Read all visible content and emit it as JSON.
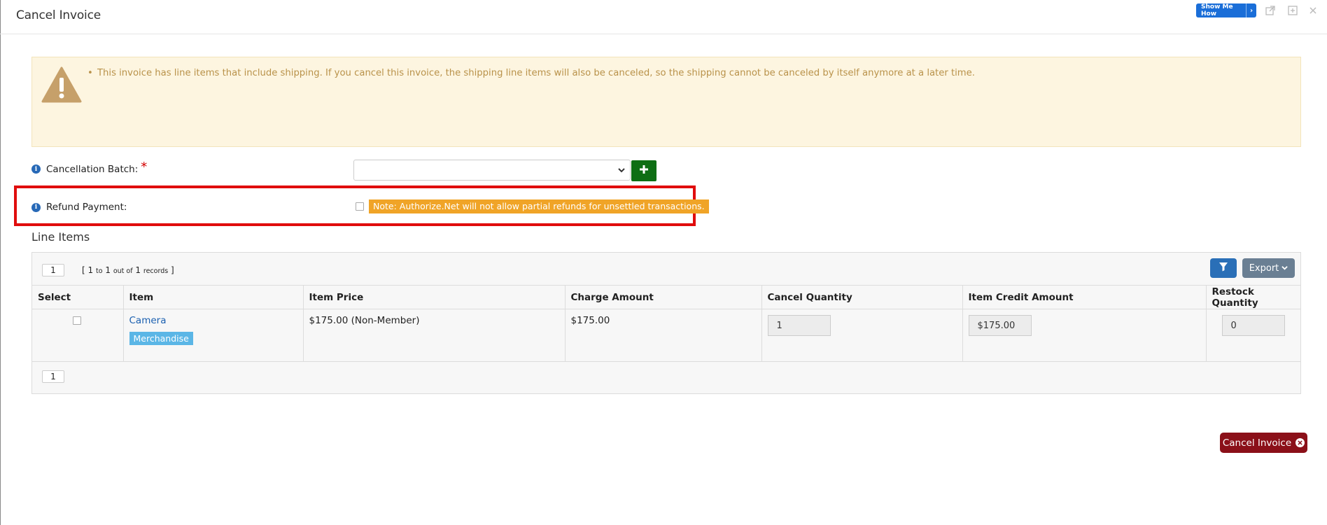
{
  "window": {
    "title": "Cancel Invoice",
    "show_me_how_label": "Show Me How"
  },
  "alert": {
    "message": "This invoice has line items that include shipping. If you cancel this invoice, the shipping line items will also be canceled, so the shipping cannot be canceled by itself anymore at a later time."
  },
  "form": {
    "cancellation_batch_label": "Cancellation Batch:",
    "required_marker": "*",
    "cancellation_batch_value": "",
    "refund_payment_label": "Refund Payment:",
    "refund_payment_checked": false,
    "refund_note": "Note: Authorize.Net will not allow partial refunds for unsettled transactions."
  },
  "line_items": {
    "section_title": "Line Items",
    "page_size": "1",
    "records_open": "[",
    "records_from": "1",
    "records_to_word": "to",
    "records_to": "1",
    "records_out_of_word": "out of",
    "records_total": "1",
    "records_word": "records",
    "records_close": "]",
    "export_label": "Export",
    "columns": [
      "Select",
      "Item",
      "Item Price",
      "Charge Amount",
      "Cancel Quantity",
      "Item Credit Amount",
      "Restock Quantity"
    ],
    "rows": [
      {
        "selected": false,
        "item_name": "Camera",
        "item_tag": "Merchandise",
        "item_price": "$175.00 (Non-Member)",
        "charge_amount": "$175.00",
        "cancel_quantity": "1",
        "item_credit_amount": "$175.00",
        "restock_quantity": "0"
      }
    ],
    "current_page": "1"
  },
  "actions": {
    "cancel_invoice_label": "Cancel Invoice"
  },
  "colors": {
    "alert_bg": "#fdf5e0",
    "alert_text": "#b9924a",
    "highlight_border": "#e00d0d",
    "note_bg": "#f0a427",
    "add_button": "#0e6e14",
    "filter_button": "#2a6fb7",
    "cancel_button": "#8b1019",
    "tag_bg": "#5bb6e6"
  },
  "icons": [
    "warning-icon",
    "info-icon",
    "plus-icon",
    "filter-icon",
    "chevron-down-icon",
    "popout-icon",
    "maximize-icon",
    "close-icon",
    "x-circle-icon"
  ]
}
